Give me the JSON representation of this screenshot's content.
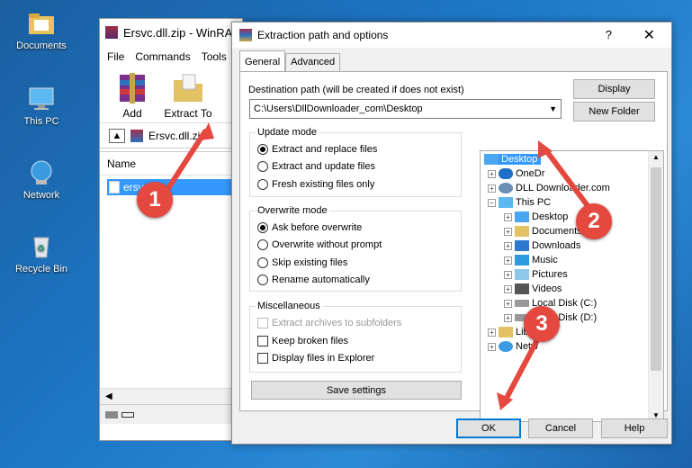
{
  "desktop": {
    "icons": [
      {
        "label": "Documents"
      },
      {
        "label": "This PC"
      },
      {
        "label": "Network"
      },
      {
        "label": "Recycle Bin"
      }
    ]
  },
  "winrar": {
    "title": "Ersvc.dll.zip - WinRA",
    "menu": [
      "File",
      "Commands",
      "Tools"
    ],
    "toolbar": {
      "add": "Add",
      "extract_to": "Extract To"
    },
    "address": "Ersvc.dll.zi",
    "list_header": "Name",
    "selected_file": "ersv"
  },
  "dialog": {
    "title": "Extraction path and options",
    "help": "?",
    "close": "✕",
    "tabs": [
      "General",
      "Advanced"
    ],
    "dest_label": "Destination path (will be created if does not exist)",
    "dest_value": "C:\\Users\\DllDownloader_com\\Desktop",
    "display_button": "Display",
    "new_folder_button": "New Folder",
    "update_mode": {
      "title": "Update mode",
      "options": [
        "Extract and replace files",
        "Extract and update files",
        "Fresh existing files only"
      ]
    },
    "overwrite_mode": {
      "title": "Overwrite mode",
      "options": [
        "Ask before overwrite",
        "Overwrite without prompt",
        "Skip existing files",
        "Rename automatically"
      ]
    },
    "misc": {
      "title": "Miscellaneous",
      "options": [
        "Extract archives to subfolders",
        "Keep broken files",
        "Display files in Explorer"
      ]
    },
    "save_settings": "Save settings",
    "tree": [
      "Desktop",
      "OneDr",
      "DLL Downloader.com",
      "This PC",
      "Desktop",
      "Documents",
      "Downloads",
      "Music",
      "Pictures",
      "Videos",
      "Local Disk (C:)",
      "Local Disk (D:)",
      "Libra",
      "Netw"
    ],
    "ok": "OK",
    "cancel": "Cancel",
    "help_button": "Help"
  },
  "annotations": [
    "1",
    "2",
    "3"
  ],
  "colors": {
    "accent": "#e5483f",
    "selection": "#3399ff"
  }
}
